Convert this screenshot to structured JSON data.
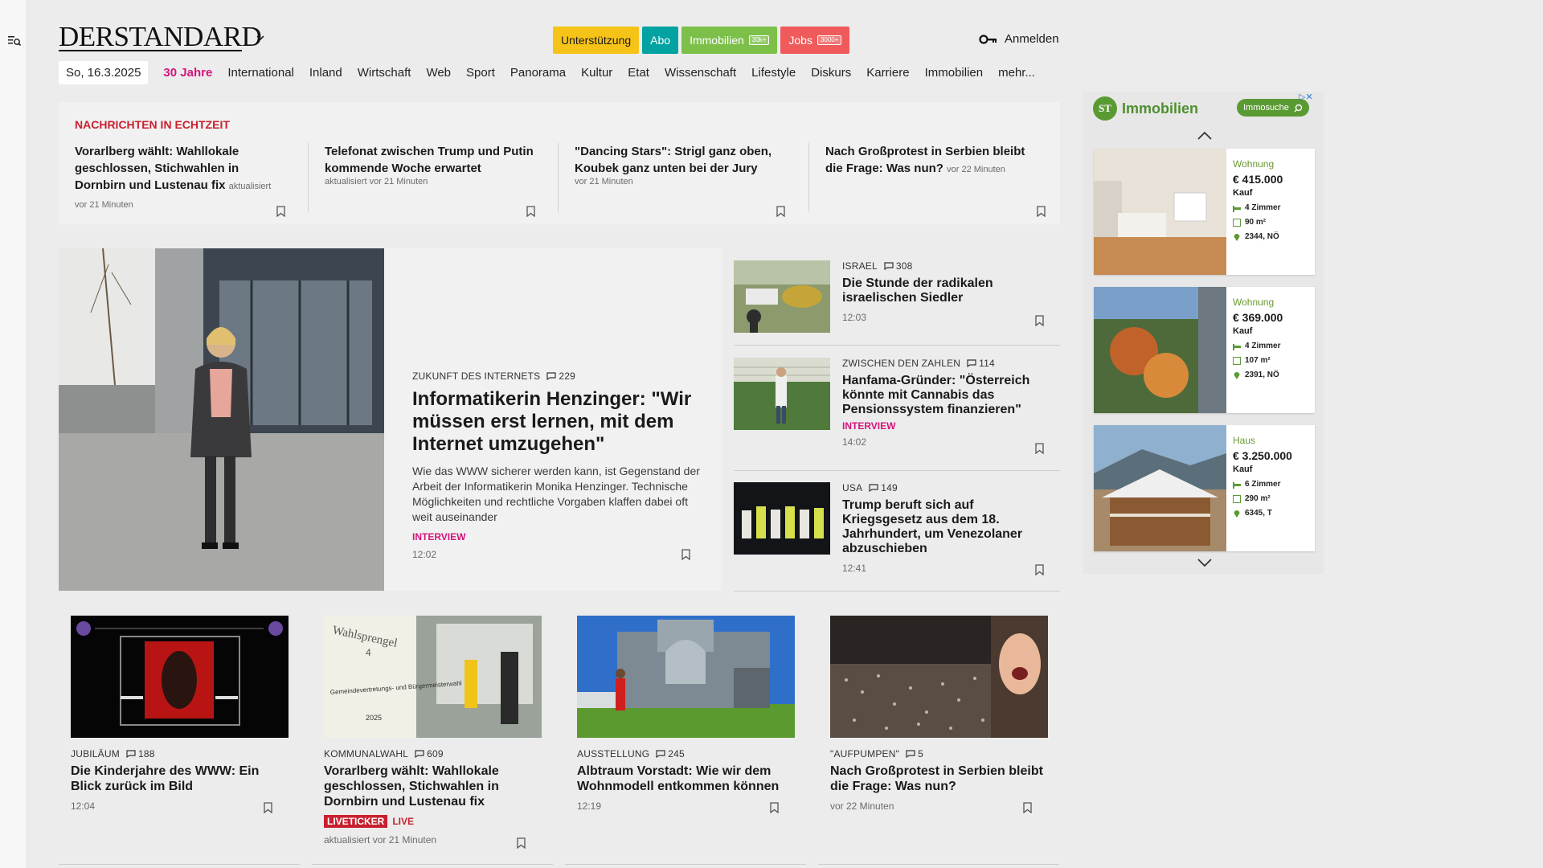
{
  "header": {
    "logo_text": "DERSTANDARD",
    "pills": [
      {
        "label": "Unterstützung",
        "bg": "#f6c318",
        "fg": "#1a1a1a",
        "badge": ""
      },
      {
        "label": "Abo",
        "bg": "#00a2a2",
        "fg": "#ffffff",
        "badge": ""
      },
      {
        "label": "Immobilien",
        "bg": "#7cc04a",
        "fg": "#ffffff",
        "badge": "30k+"
      },
      {
        "label": "Jobs",
        "bg": "#ef5b5b",
        "fg": "#ffffff",
        "badge": "3000+"
      }
    ],
    "login_label": "Anmelden"
  },
  "nav": {
    "date": "So, 16.3.2025",
    "highlight": "30 Jahre",
    "items": [
      "International",
      "Inland",
      "Wirtschaft",
      "Web",
      "Sport",
      "Panorama",
      "Kultur",
      "Etat",
      "Wissenschaft",
      "Lifestyle",
      "Diskurs",
      "Karriere",
      "Immobilien",
      "mehr..."
    ]
  },
  "realtime": {
    "title": "NACHRICHTEN IN ECHTZEIT",
    "items": [
      {
        "headline": "Vorarlberg wählt: Wahllokale geschlossen, Stichwahlen in Dornbirn und Lustenau fix",
        "meta": "aktualisiert vor 21 Minuten"
      },
      {
        "headline": "Telefonat zwischen Trump und Putin kommende Woche erwartet",
        "meta": "aktualisiert vor 21 Minuten"
      },
      {
        "headline": "\"Dancing Stars\": Strigl ganz oben, Koubek ganz unten bei der Jury",
        "meta": "vor 21 Minuten"
      },
      {
        "headline": "Nach Großprotest in Serbien bleibt die Frage: Was nun?",
        "meta": "vor 22 Minuten"
      }
    ]
  },
  "hero": {
    "kicker": "ZUKUNFT DES INTERNETS",
    "comments": "229",
    "headline": "Informatikerin Henzinger: \"Wir müssen erst lernen, mit dem Internet umzugehen\"",
    "teaser": "Wie das WWW sicherer werden kann, ist Gegenstand der Arbeit der Informatikerin Monika Henzinger. Technische Möglichkeiten und rechtliche Vorgaben klaffen dabei oft weit auseinander",
    "tag": "INTERVIEW",
    "time": "12:02"
  },
  "side": [
    {
      "kicker": "ISRAEL",
      "comments": "308",
      "headline": "Die Stunde der radikalen israelischen Siedler",
      "tag": "",
      "time": "12:03"
    },
    {
      "kicker": "ZWISCHEN DEN ZAHLEN",
      "comments": "114",
      "headline": "Hanfama-Gründer: \"Österreich könnte mit Cannabis das Pensionssystem finanzieren\"",
      "tag": "INTERVIEW",
      "time": "14:02"
    },
    {
      "kicker": "USA",
      "comments": "149",
      "headline": "Trump beruft sich auf Kriegsgesetz aus dem 18. Jahrhundert, um Venezolaner abzuschieben",
      "tag": "",
      "time": "12:41"
    }
  ],
  "cards": [
    {
      "kicker": "JUBILÄUM",
      "comments": "188",
      "headline": "Die Kinderjahre des WWW: Ein Blick zurück im Bild",
      "time": "12:04"
    },
    {
      "kicker": "KOMMUNALWAHL",
      "comments": "609",
      "headline": "Vorarlberg wählt: Wahllokale geschlossen, Stichwahlen in Dornbirn und Lustenau fix",
      "live_badge": "LIVETICKER",
      "live_text": "LIVE",
      "time": "aktualisiert vor 21 Minuten"
    },
    {
      "kicker": "AUSSTELLUNG",
      "comments": "245",
      "headline": "Albtraum Vorstadt: Wie wir dem Wohnmodell entkommen können",
      "time": "12:19"
    },
    {
      "kicker": "\"AUFPUMPEN\"",
      "comments": "5",
      "headline": "Nach Großprotest in Serbien bleibt die Frage: Was nun?",
      "time": "vor 22 Minuten"
    }
  ],
  "card_images": {
    "card1_sign_line1": "Wahlsprengel",
    "card1_sign_line2": "4",
    "card1_sign_line3": "Gemeindevertretungs- und Bürgermeisterwahl",
    "card1_sign_line4": "2025"
  },
  "ad": {
    "logo_text": "ST",
    "title": "Immobilien",
    "button": "Immosuche",
    "listings": [
      {
        "type": "Wohnung",
        "price": "€ 415.000",
        "deal": "Kauf",
        "rooms": "4 Zimmer",
        "area": "90 m²",
        "location": "2344, NÖ"
      },
      {
        "type": "Wohnung",
        "price": "€ 369.000",
        "deal": "Kauf",
        "rooms": "4 Zimmer",
        "area": "107 m²",
        "location": "2391, NÖ"
      },
      {
        "type": "Haus",
        "price": "€ 3.250.000",
        "deal": "Kauf",
        "rooms": "6 Zimmer",
        "area": "290 m²",
        "location": "6345, T"
      }
    ]
  },
  "colors": {
    "accent_pink": "#d4147c",
    "accent_red": "#c8202f",
    "immo_green": "#5a9a33"
  }
}
